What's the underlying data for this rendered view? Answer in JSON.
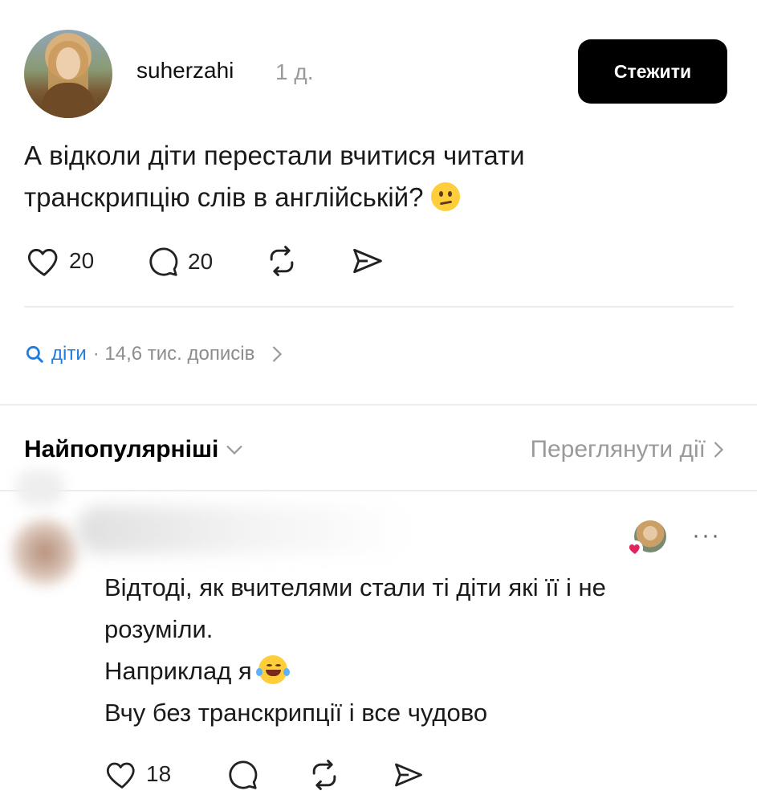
{
  "post": {
    "username": "suherzahi",
    "time": "1 д.",
    "follow_label": "Стежити",
    "text_line1": "А відколи діти перестали вчитися читати",
    "text_line2": "транскрипцію слів в англійській?",
    "emoji": "neutral-face",
    "likes": "20",
    "comments": "20"
  },
  "tag": {
    "name": "діти",
    "meta": "· 14,6 тис. дописів"
  },
  "sort": {
    "label": "Найпопулярніші",
    "view_activity": "Переглянути дії"
  },
  "comment": {
    "lines": [
      "Відтоді, як вчителями стали ті діти які її і не",
      "розуміли.",
      "Наприклад я",
      "Вчу без транскрипції і все чудово"
    ],
    "emoji": "laughing-tears",
    "likes": "18",
    "more": "···"
  },
  "colors": {
    "accent": "#1d7de0",
    "button_bg": "#000000",
    "muted": "#9a9a9a",
    "like_heart": "#e0245e"
  }
}
